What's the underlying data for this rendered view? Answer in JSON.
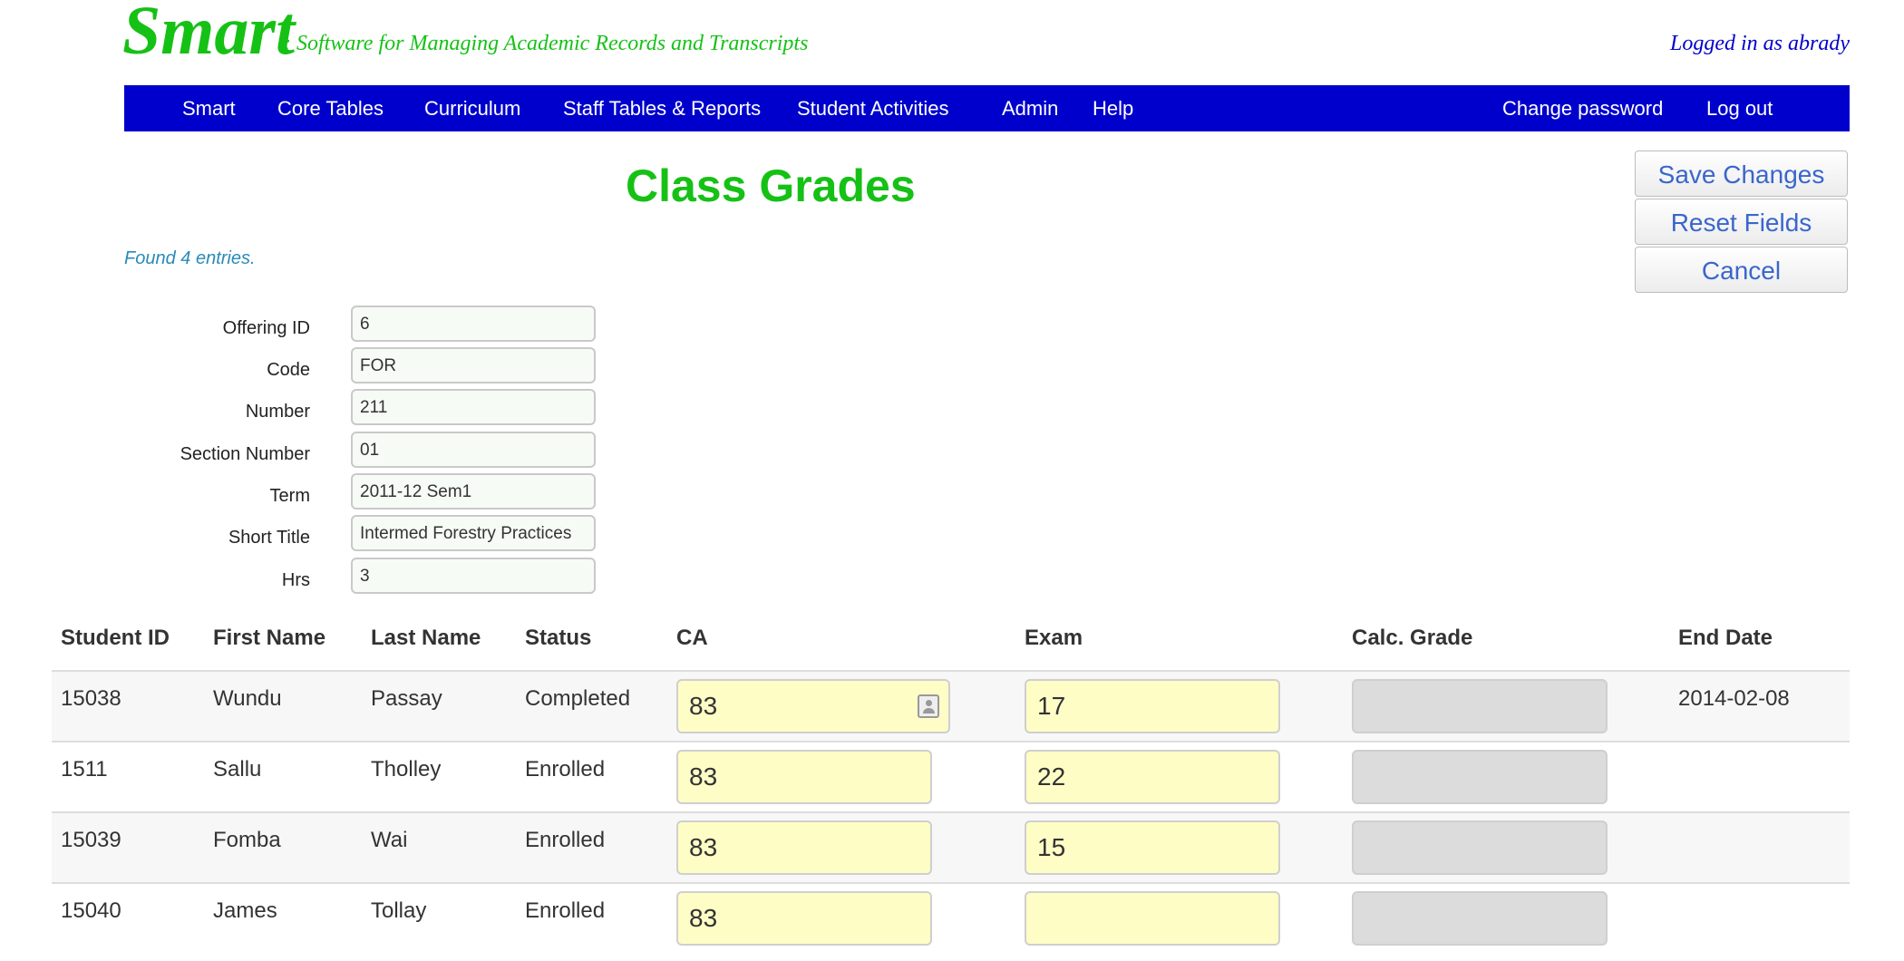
{
  "header": {
    "brand": "Smart",
    "tagline": ": Software for Managing Academic Records and Transcripts",
    "logged_in": "Logged in as abrady"
  },
  "nav": {
    "items": [
      "Smart",
      "Core Tables",
      "Curriculum",
      "Staff Tables & Reports",
      "Student Activities",
      "Admin",
      "Help"
    ],
    "right_items": [
      "Change password",
      "Log out"
    ]
  },
  "page": {
    "title": "Class Grades",
    "found": "Found 4 entries."
  },
  "actions": {
    "save": "Save Changes",
    "reset": "Reset Fields",
    "cancel": "Cancel"
  },
  "form": {
    "offering_id": {
      "label": "Offering ID",
      "value": "6"
    },
    "code": {
      "label": "Code",
      "value": "FOR"
    },
    "number": {
      "label": "Number",
      "value": "211"
    },
    "section": {
      "label": "Section Number",
      "value": "01"
    },
    "term": {
      "label": "Term",
      "value": "2011-12 Sem1"
    },
    "short_title": {
      "label": "Short Title",
      "value": "Intermed Forestry Practices"
    },
    "hrs": {
      "label": "Hrs",
      "value": "3"
    }
  },
  "table": {
    "headers": [
      "Student ID",
      "First Name",
      "Last Name",
      "Status",
      "CA",
      "Exam",
      "Calc. Grade",
      "End Date"
    ],
    "rows": [
      {
        "student_id": "15038",
        "first_name": "Wundu",
        "last_name": "Passay",
        "status": "Completed",
        "ca": "83",
        "exam": "17",
        "calc": "",
        "end_date": "2014-02-08"
      },
      {
        "student_id": "1511",
        "first_name": "Sallu",
        "last_name": "Tholley",
        "status": "Enrolled",
        "ca": "83",
        "exam": "22",
        "calc": "",
        "end_date": ""
      },
      {
        "student_id": "15039",
        "first_name": "Fomba",
        "last_name": "Wai",
        "status": "Enrolled",
        "ca": "83",
        "exam": "15",
        "calc": "",
        "end_date": ""
      },
      {
        "student_id": "15040",
        "first_name": "James",
        "last_name": "Tollay",
        "status": "Enrolled",
        "ca": "83",
        "exam": "",
        "calc": "",
        "end_date": ""
      }
    ]
  },
  "colors": {
    "brand_green": "#16c116",
    "nav_blue": "#0000cc",
    "input_yellow": "#fffdc6"
  }
}
